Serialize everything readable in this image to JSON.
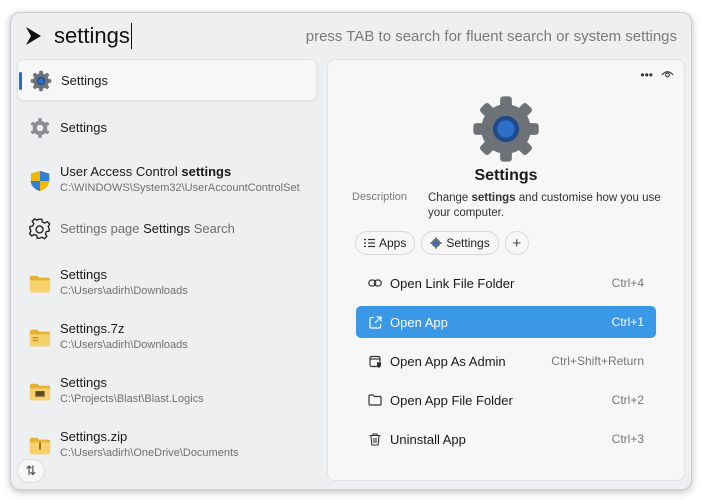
{
  "search": {
    "query": "settings",
    "hint": "press TAB to search for fluent search or system settings"
  },
  "results": [
    {
      "title_plain": "",
      "title_bold": "Settings",
      "title_after": "",
      "subtitle": "",
      "icon": "gear-icon"
    },
    {
      "title_plain": "",
      "title_bold": "Settings",
      "title_after": "",
      "subtitle": "",
      "icon": "gear-outline-icon"
    },
    {
      "title_plain": "User Access Control ",
      "title_bold": "settings",
      "title_after": "",
      "subtitle": "C:\\WINDOWS\\System32\\UserAccountControlSet",
      "icon": "shield-icon"
    },
    {
      "title_plain": "Settings page ",
      "title_bold": "Settings",
      "title_after": " Search",
      "subtitle": "",
      "icon": "gear-line-icon"
    },
    {
      "title_plain": "",
      "title_bold": "Settings",
      "title_after": "",
      "subtitle": "C:\\Users\\adirh\\Downloads",
      "icon": "folder-icon"
    },
    {
      "title_plain": "",
      "title_bold": "Settings",
      "title_after": ".7z",
      "subtitle": "C:\\Users\\adirh\\Downloads",
      "icon": "archive-folder-icon"
    },
    {
      "title_plain": "",
      "title_bold": "Settings",
      "title_after": "",
      "subtitle": "C:\\Projects\\Blast\\Blast.Logics",
      "icon": "project-folder-icon"
    },
    {
      "title_plain": "",
      "title_bold": "Settings",
      "title_after": ".zip",
      "subtitle": "C:\\Users\\adirh\\OneDrive\\Documents",
      "icon": "zip-folder-icon"
    }
  ],
  "sort_button": "⇅",
  "preview": {
    "title": "Settings",
    "description_label": "Description",
    "description_before": "Change ",
    "description_bold": "settings",
    "description_after": " and customise how you use your computer.",
    "chips": [
      {
        "label": "Apps",
        "icon": "list-icon"
      },
      {
        "label": "Settings",
        "icon": "gear-icon"
      }
    ],
    "add_chip": "+",
    "actions": [
      {
        "label": "Open Link File Folder",
        "shortcut": "Ctrl+4",
        "icon": "link-icon"
      },
      {
        "label": "Open App",
        "shortcut": "Ctrl+1",
        "icon": "open-external-icon"
      },
      {
        "label": "Open App As Admin",
        "shortcut": "Ctrl+Shift+Return",
        "icon": "admin-shield-icon"
      },
      {
        "label": "Open App File Folder",
        "shortcut": "Ctrl+2",
        "icon": "folder-outline-icon"
      },
      {
        "label": "Uninstall App",
        "shortcut": "Ctrl+3",
        "icon": "trash-icon"
      }
    ]
  },
  "colors": {
    "accent": "#3a98e6",
    "indicator": "#1f6fd1",
    "folder": "#f3c44b"
  }
}
